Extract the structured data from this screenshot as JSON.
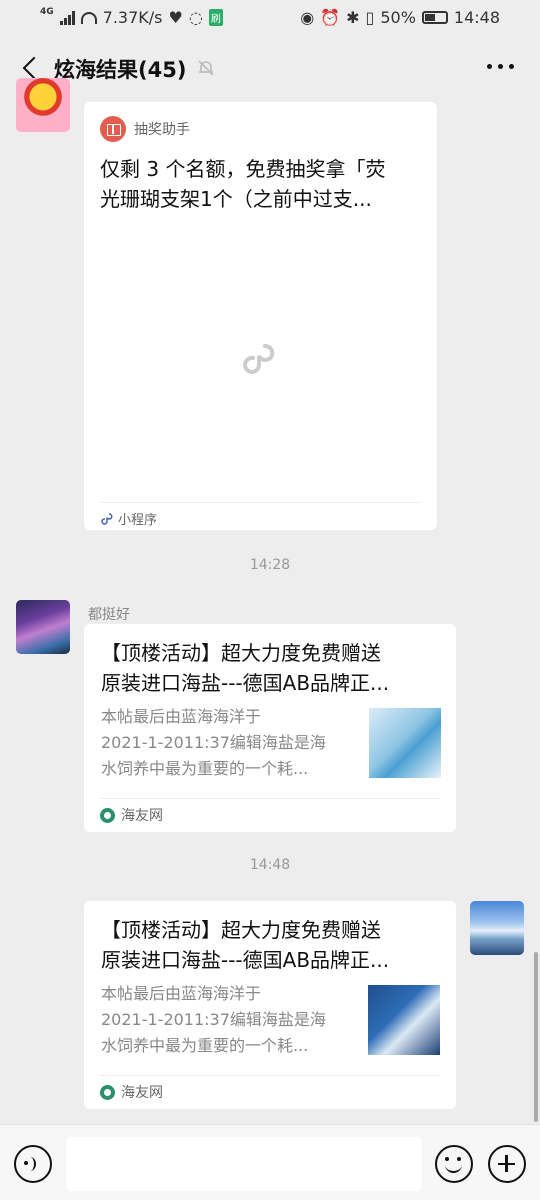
{
  "status_bar": {
    "network": "4G",
    "speed": "7.37K/s",
    "data_badge": "刷",
    "battery": "50%",
    "time": "14:48"
  },
  "header": {
    "title": "炫海结果(45)"
  },
  "messages": {
    "miniprogram": {
      "app_name": "抽奖助手",
      "title_line1": "仅剩 3 个名额，免费抽奖拿「荧",
      "title_line2": "光珊瑚支架1个（之前中过支...",
      "footer": "小程序"
    },
    "time1": "14:28",
    "link1": {
      "sender": "都挺好",
      "title_line1": "【顶楼活动】超大力度免费赠送",
      "title_line2": "原装进口海盐---德国AB品牌正...",
      "desc_line1": "本帖最后由蓝海海洋于",
      "desc_line2": "2021-1-2011:37编辑海盐是海",
      "desc_line3": "水饲养中最为重要的一个耗...",
      "source": "海友网"
    },
    "time2": "14:48",
    "link2": {
      "title_line1": "【顶楼活动】超大力度免费赠送",
      "title_line2": "原装进口海盐---德国AB品牌正...",
      "desc_line1": "本帖最后由蓝海海洋于",
      "desc_line2": "2021-1-2011:37编辑海盐是海",
      "desc_line3": "水饲养中最为重要的一个耗...",
      "source": "海友网"
    }
  },
  "input_bar": {
    "value": ""
  }
}
